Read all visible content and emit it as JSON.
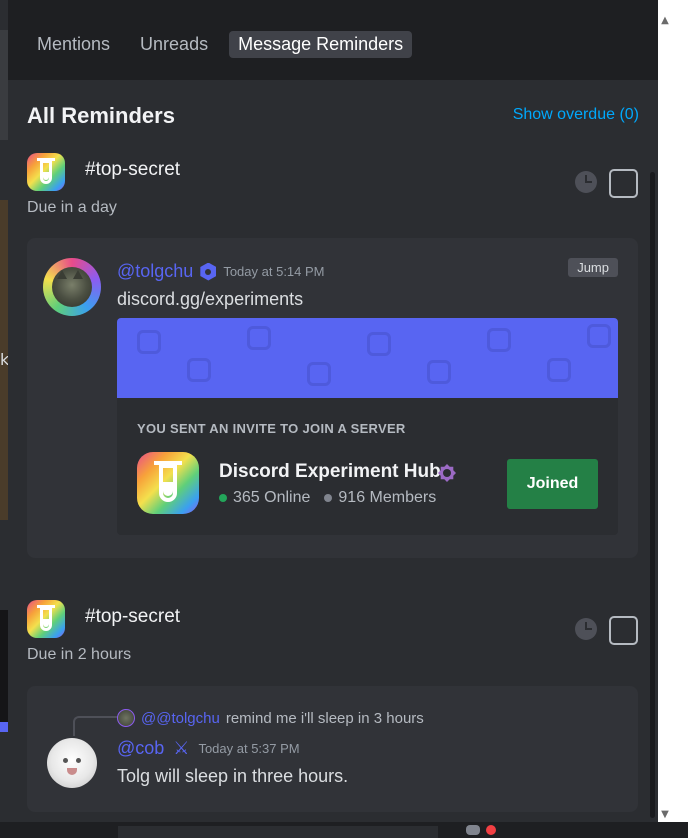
{
  "tabs": [
    {
      "label": "Mentions",
      "active": false
    },
    {
      "label": "Unreads",
      "active": false
    },
    {
      "label": "Message Reminders",
      "active": true
    }
  ],
  "panel": {
    "title": "All Reminders",
    "show_overdue": "Show overdue (0)"
  },
  "background": {
    "left_char": "k"
  },
  "reminders": [
    {
      "channel": "#top-secret",
      "due": "Due in a day",
      "message": {
        "author": "@tolgchu",
        "timestamp": "Today at 5:14 PM",
        "jump_label": "Jump",
        "text": "discord.gg/experiments",
        "invite": {
          "label": "YOU SENT AN INVITE TO JOIN A SERVER",
          "server_name": "Discord Experiment Hub",
          "online": "365 Online",
          "members": "916 Members",
          "button": "Joined"
        }
      }
    },
    {
      "channel": "#top-secret",
      "due": "Due in 2 hours",
      "message": {
        "reply_author": "@@tolgchu",
        "reply_text": "remind me i'll sleep in 3 hours",
        "author": "@cob",
        "timestamp": "Today at 5:37 PM",
        "text": "Tolg will sleep in three hours."
      }
    }
  ],
  "icons": {
    "guild": "rainbow-flask-icon",
    "clock": "clock-icon",
    "shield": "shield-badge-icon",
    "hub": "hub-badge-icon",
    "swords": "crossed-swords-icon"
  },
  "colors": {
    "accent": "#5865f2",
    "link": "#00a8fc",
    "joined": "#248046",
    "online": "#23a55a"
  }
}
